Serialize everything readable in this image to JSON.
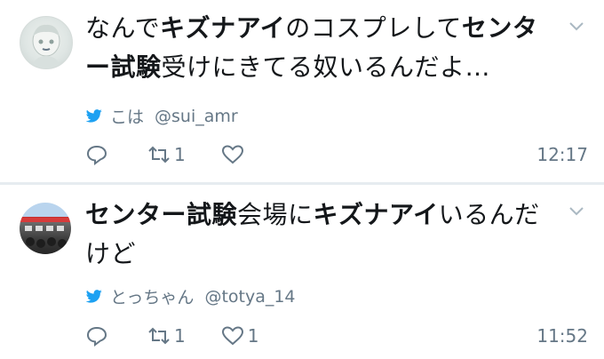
{
  "tweets": [
    {
      "text_segments": [
        {
          "text": "なんで",
          "bold": false
        },
        {
          "text": "キズナアイ",
          "bold": true
        },
        {
          "text": "のコスプレして",
          "bold": false
        },
        {
          "text": "センター試験",
          "bold": true
        },
        {
          "text": "受けにきてる奴いるんだよ…",
          "bold": false
        }
      ],
      "display_name": "こは",
      "handle": "@sui_amr",
      "reply_count": "",
      "retweet_count": "1",
      "like_count": "",
      "time": "12:17"
    },
    {
      "text_segments": [
        {
          "text": "センター試験",
          "bold": true
        },
        {
          "text": "会場に",
          "bold": false
        },
        {
          "text": "キズナアイ",
          "bold": true
        },
        {
          "text": "いるんだけど",
          "bold": false
        }
      ],
      "display_name": "とっちゃん",
      "handle": "@totya_14",
      "reply_count": "",
      "retweet_count": "1",
      "like_count": "1",
      "time": "11:52"
    }
  ],
  "icons": {
    "bird": "twitter-bird-icon",
    "reply": "reply-icon",
    "retweet": "retweet-icon",
    "like": "heart-icon",
    "menu": "chevron-down-icon"
  },
  "colors": {
    "brand": "#1da1f2",
    "muted": "#657786",
    "divider": "#e6ecf0"
  }
}
